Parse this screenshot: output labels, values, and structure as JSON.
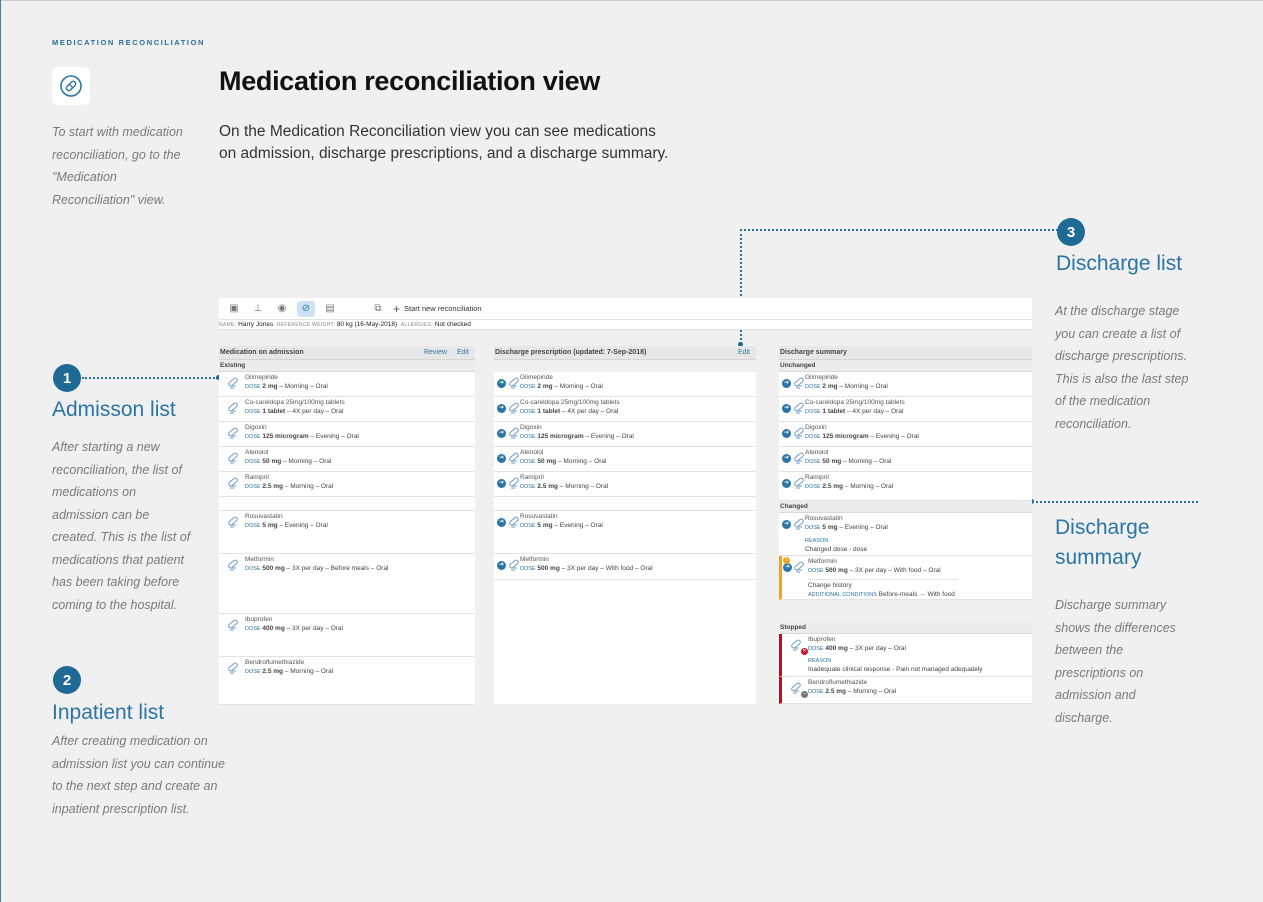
{
  "eyebrow": "MEDICATION RECONCILIATION",
  "title": "Medication reconciliation view",
  "intro_line1": "On the Medication Reconciliation view you can see medications",
  "intro_line2": "on admission, discharge prescriptions, and a discharge summary.",
  "start_note": [
    "To start with medication",
    "reconciliation, go to the",
    "\"Medication",
    "Reconciliation\" view."
  ],
  "sections": {
    "admission": {
      "number": "1",
      "title": "Admisson list",
      "note": [
        "After starting a new",
        "reconciliation, the list of",
        "medications on",
        "admission can be",
        "created. This is the list of",
        "medications that patient",
        "has been taking before",
        "coming to the hospital."
      ]
    },
    "inpatient": {
      "number": "2",
      "title": "Inpatient list",
      "note": [
        "After creating medication on",
        "admission list you can continue",
        "to the next step and create an",
        "inpatient prescription list."
      ]
    },
    "discharge": {
      "number": "3",
      "title": "Discharge list",
      "note": [
        "At the discharge stage",
        "you can create a list of",
        "discharge prescriptions.",
        "This is also the last step",
        "of the medication",
        "reconciliation."
      ]
    },
    "summary": {
      "title_line1": "Discharge",
      "title_line2": "summary",
      "note": [
        "Discharge summary",
        "shows the differences",
        "between the",
        "prescriptions on",
        "admission and",
        "discharge."
      ]
    }
  },
  "app": {
    "toolbar": {
      "new_label": "Start new reconciliation"
    },
    "patient": {
      "name_key": "NAME:",
      "name": "Harry Jones",
      "weight_key": "REFERENCE WEIGHT:",
      "weight": "80 kg (16-May-2018)",
      "allergies_key": "ALLERGIES:",
      "allergies": "Not checked"
    },
    "dose_key": "DOSE",
    "admission": {
      "header": "Medication on admission",
      "review": "Review",
      "edit": "Edit",
      "group": "Existing",
      "items": [
        {
          "name": "Glimepiride",
          "dose": "2 mg",
          "rest": " – Morning – Oral"
        },
        {
          "name": "Co-careldopa 25mg/100mg tablets",
          "dose": "1 tablet",
          "rest": " – 4X per day – Oral"
        },
        {
          "name": "Digoxin",
          "dose": "125 microgram",
          "rest": " – Evening – Oral"
        },
        {
          "name": "Atenolol",
          "dose": "50 mg",
          "rest": " – Morning – Oral"
        },
        {
          "name": "Ramipril",
          "dose": "2.5 mg",
          "rest": " – Morning – Oral"
        },
        {
          "name": "Rosuvastatin",
          "dose": "5 mg",
          "rest": " – Evening – Oral"
        },
        {
          "name": "Metformin",
          "dose": "500 mg",
          "rest": " – 3X per day – Before meals – Oral"
        },
        {
          "name": "Ibuprofen",
          "dose": "400 mg",
          "rest": " – 3X per day – Oral"
        },
        {
          "name": "Bendroflumethiazide",
          "dose": "2.5 mg",
          "rest": " – Morning – Oral"
        }
      ]
    },
    "discharge": {
      "header": "Discharge prescription (updated: 7-Sep-2018)",
      "edit": "Edit",
      "items": [
        {
          "name": "Glimepiride",
          "dose": "2 mg",
          "rest": " – Morning – Oral"
        },
        {
          "name": "Co-careldopa 25mg/100mg tablets",
          "dose": "1 tablet",
          "rest": " – 4X per day – Oral"
        },
        {
          "name": "Digoxin",
          "dose": "125 microgram",
          "rest": " – Evening – Oral"
        },
        {
          "name": "Atenolol",
          "dose": "50 mg",
          "rest": " – Morning – Oral"
        },
        {
          "name": "Ramipril",
          "dose": "2.5 mg",
          "rest": " – Morning – Oral"
        },
        {
          "name": "Rosuvastatin",
          "dose": "5 mg",
          "rest": " – Evening – Oral"
        },
        {
          "name": "Metformin",
          "dose": "500 mg",
          "rest": " – 3X per day – With food – Oral"
        }
      ]
    },
    "summary": {
      "header": "Discharge summary",
      "unchanged": "Unchanged",
      "changed": "Changed",
      "stopped": "Stopped",
      "reason_key": "REASON",
      "unchanged_items": [
        {
          "name": "Glimepiride",
          "dose": "2 mg",
          "rest": " – Morning – Oral"
        },
        {
          "name": "Co-careldopa 25mg/100mg tablets",
          "dose": "1 tablet",
          "rest": " – 4X per day – Oral"
        },
        {
          "name": "Digoxin",
          "dose": "125 microgram",
          "rest": " – Evening – Oral"
        },
        {
          "name": "Atenolol",
          "dose": "50 mg",
          "rest": " – Morning – Oral"
        },
        {
          "name": "Ramipril",
          "dose": "2.5 mg",
          "rest": " – Morning – Oral"
        }
      ],
      "rosuvastatin": {
        "name": "Rosuvastatin",
        "dose": "5 mg",
        "rest": " – Evening – Oral",
        "reason": "Changed dose - dose"
      },
      "metformin": {
        "name": "Metformin",
        "dose": "500 mg",
        "rest": " – 3X per day – With food – Oral",
        "history": "Change history",
        "cond_key": "ADDITIONAL CONDITIONS",
        "cond_from": "Before-meals",
        "cond_to": "With food"
      },
      "ibuprofen": {
        "name": "Ibuprofen",
        "dose": "400 mg",
        "rest": " – 3X per day – Oral",
        "reason": "Inadequate clinical response - Pain not managed adequately"
      },
      "bendro": {
        "name": "Bendroflumethiazide",
        "dose": "2.5 mg",
        "rest": " – Morning – Oral"
      }
    }
  }
}
